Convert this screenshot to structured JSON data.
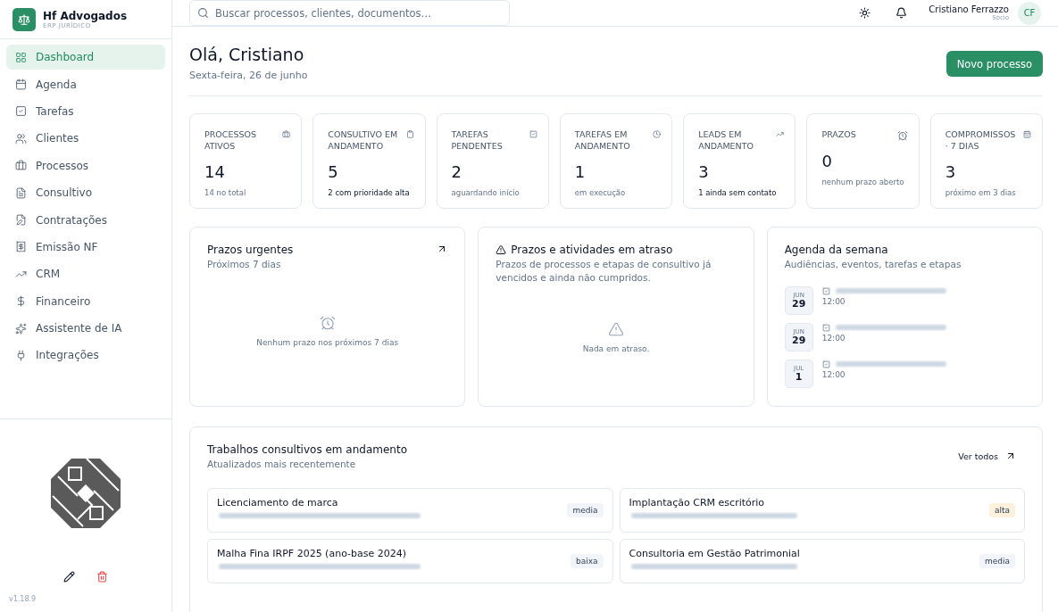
{
  "brand": {
    "name": "Hf Advogados",
    "subtitle": "ERP JURÍDICO"
  },
  "sidebar": {
    "items": [
      {
        "label": "Dashboard",
        "selected": true
      },
      {
        "label": "Agenda",
        "selected": false
      },
      {
        "label": "Tarefas",
        "selected": false
      },
      {
        "label": "Clientes",
        "selected": false
      },
      {
        "label": "Processos",
        "selected": false
      },
      {
        "label": "Consultivo",
        "selected": false
      },
      {
        "label": "Contratações",
        "selected": false
      },
      {
        "label": "Emissão NF",
        "selected": false
      },
      {
        "label": "CRM",
        "selected": false
      },
      {
        "label": "Financeiro",
        "selected": false
      },
      {
        "label": "Assistente de IA",
        "selected": false
      },
      {
        "label": "Integrações",
        "selected": false
      }
    ],
    "version": "v1.18.9"
  },
  "search": {
    "placeholder": "Buscar processos, clientes, documentos…"
  },
  "user": {
    "name": "Cristiano Ferrazzo",
    "role": "Socio",
    "initials": "CF"
  },
  "greeting": {
    "title": "Olá, Cristiano",
    "date": "Sexta-feira, 26 de junho"
  },
  "primary_button": "Novo processo",
  "stats": [
    {
      "label": "PROCESSOS ATIVOS",
      "value": "14",
      "note": "14 no total",
      "highlight": false
    },
    {
      "label": "CONSULTIVO EM ANDAMENTO",
      "value": "5",
      "note": "2 com prioridade alta",
      "highlight": true
    },
    {
      "label": "TAREFAS PENDENTES",
      "value": "2",
      "note": "aguardando início",
      "highlight": false
    },
    {
      "label": "TAREFAS EM ANDAMENTO",
      "value": "1",
      "note": "em execução",
      "highlight": false
    },
    {
      "label": "LEADS EM ANDAMENTO",
      "value": "3",
      "note": "1 ainda sem contato",
      "highlight": true
    },
    {
      "label": "PRAZOS",
      "value": "0",
      "note": "nenhum prazo aberto",
      "highlight": false
    },
    {
      "label": "COMPROMISSOS · 7 DIAS",
      "value": "3",
      "note": "próximo em 3 dias",
      "highlight": false
    }
  ],
  "urgent": {
    "title": "Prazos urgentes",
    "subtitle": "Próximos 7 dias",
    "empty": "Nenhum prazo nos próximos 7 dias"
  },
  "overdue": {
    "title": "Prazos e atividades em atraso",
    "subtitle": "Prazos de processos e etapas de consultivo já vencidos e ainda não cumpridos.",
    "empty": "Nada em atraso."
  },
  "agenda": {
    "title": "Agenda da semana",
    "subtitle": "Audiências, eventos, tarefas e etapas",
    "items": [
      {
        "month": "JUN",
        "day": "29",
        "time": "12:00"
      },
      {
        "month": "JUN",
        "day": "29",
        "time": "12:00"
      },
      {
        "month": "JUL",
        "day": "1",
        "time": "12:00"
      }
    ]
  },
  "consultivo": {
    "title": "Trabalhos consultivos em andamento",
    "subtitle": "Atualizados mais recentemente",
    "link": "Ver todos",
    "items": [
      {
        "title": "Licenciamento de marca",
        "priority": "media",
        "color": "#f1f5f9"
      },
      {
        "title": "Implantação CRM escritório",
        "priority": "alta",
        "color": "#fdf0dc"
      },
      {
        "title": "Malha Fina IRPF 2025 (ano-base 2024)",
        "priority": "baixa",
        "color": "#f1f5f9"
      },
      {
        "title": "Consultoria em Gestão Patrimonial",
        "priority": "media",
        "color": "#f1f5f9"
      }
    ]
  }
}
